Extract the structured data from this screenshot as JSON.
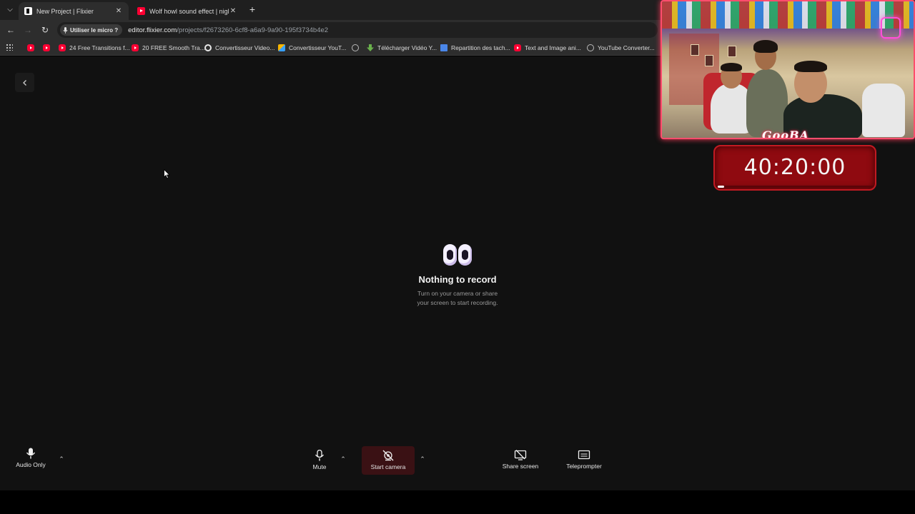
{
  "browser": {
    "tabs": [
      {
        "title": "New Project | Flixier",
        "favicon": "flixier-icon",
        "active": true
      },
      {
        "title": "Wolf howl sound effect | night",
        "favicon": "youtube-icon",
        "active": false
      }
    ],
    "mic_chip": "Utiliser le micro ?",
    "url_host": "editor.flixier.com",
    "url_path": "/projects/f2673260-6cf8-a6a9-9a90-195f3734b4e2",
    "bookmarks": [
      {
        "label": "",
        "icon": "youtube-icon"
      },
      {
        "label": "",
        "icon": "youtube-icon"
      },
      {
        "label": "24 Free Transitions f...",
        "icon": "youtube-icon"
      },
      {
        "label": "20 FREE Smooth Tra...",
        "icon": "youtube-icon"
      },
      {
        "label": "Convertisseur Video...",
        "icon": "google-icon"
      },
      {
        "label": "Convertisseur YouT...",
        "icon": "converter-icon"
      },
      {
        "label": "",
        "icon": "globe-icon"
      },
      {
        "label": "Télécharger Vidéo Y...",
        "icon": "download-icon"
      },
      {
        "label": "Repartition des tach...",
        "icon": "docs-icon"
      },
      {
        "label": "Text and Image ani...",
        "icon": "youtube-icon"
      },
      {
        "label": "YouTube Converter...",
        "icon": "globe-icon"
      }
    ]
  },
  "recorder": {
    "empty_title": "Nothing to record",
    "empty_line1": "Turn on your camera or share",
    "empty_line2": "your screen to start recording."
  },
  "controls": {
    "audio_only": "Audio Only",
    "mute": "Mute",
    "start_camera": "Start camera",
    "share_screen": "Share screen",
    "teleprompter": "Teleprompter"
  },
  "overlay": {
    "webcam_logo": "GooBA",
    "timer": "40:20:00",
    "timer_progress": 0.04
  },
  "colors": {
    "accent_red": "#8f0a10",
    "camera_active_bg": "#3a1114",
    "app_bg": "#111111"
  }
}
